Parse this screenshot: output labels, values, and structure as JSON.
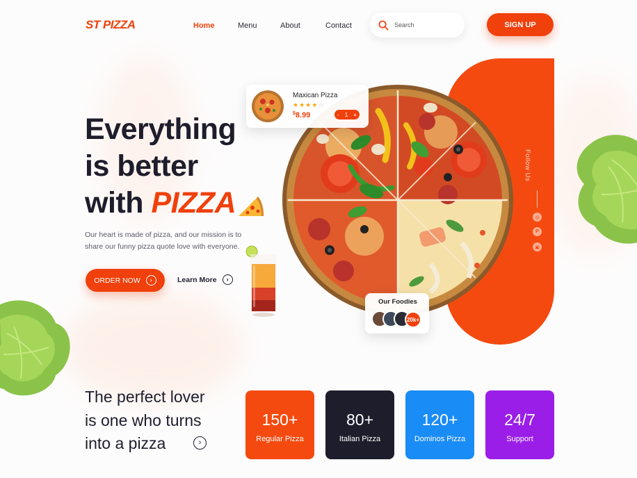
{
  "header": {
    "logo": "ST PIZZA",
    "nav": [
      "Home",
      "Menu",
      "About",
      "Contact"
    ],
    "active_nav": "Home",
    "search_placeholder": "Search",
    "signup_label": "SIGN UP"
  },
  "hero": {
    "title_line1": "Everything",
    "title_line2": "is better",
    "title_line3_prefix": "with ",
    "title_highlight": "PIZZA",
    "description": "Our heart is made of pizza, and our mission is to share our funny pizza quote love with everyone.",
    "order_label": "ORDER NOW",
    "learn_label": "Learn More"
  },
  "product_card": {
    "name": "Maxican Pizza",
    "rating": 4,
    "rating_max": 5,
    "currency": "$",
    "price": "8.99",
    "quantity": "1",
    "minus": "-",
    "plus": "+"
  },
  "social": {
    "follow_label": "Follow Us",
    "icons": [
      "instagram-icon",
      "pinterest-icon",
      "twitch-icon"
    ]
  },
  "foodies": {
    "title": "Our Foodies",
    "count": "20k+"
  },
  "bottom": {
    "title_line1": "The perfect lover",
    "title_line2": "is one who turns",
    "title_line3": "into a pizza"
  },
  "stats": [
    {
      "value": "150+",
      "label": "Regular Pizza",
      "color": "#f44a10"
    },
    {
      "value": "80+",
      "label": "Italian Pizza",
      "color": "#1e1d2c"
    },
    {
      "value": "120+",
      "label": "Dominos Pizza",
      "color": "#1a8cf5"
    },
    {
      "value": "24/7",
      "label": "Support",
      "color": "#9a1ee8"
    }
  ],
  "colors": {
    "accent": "#f0400c",
    "dark": "#1e1d2c"
  }
}
